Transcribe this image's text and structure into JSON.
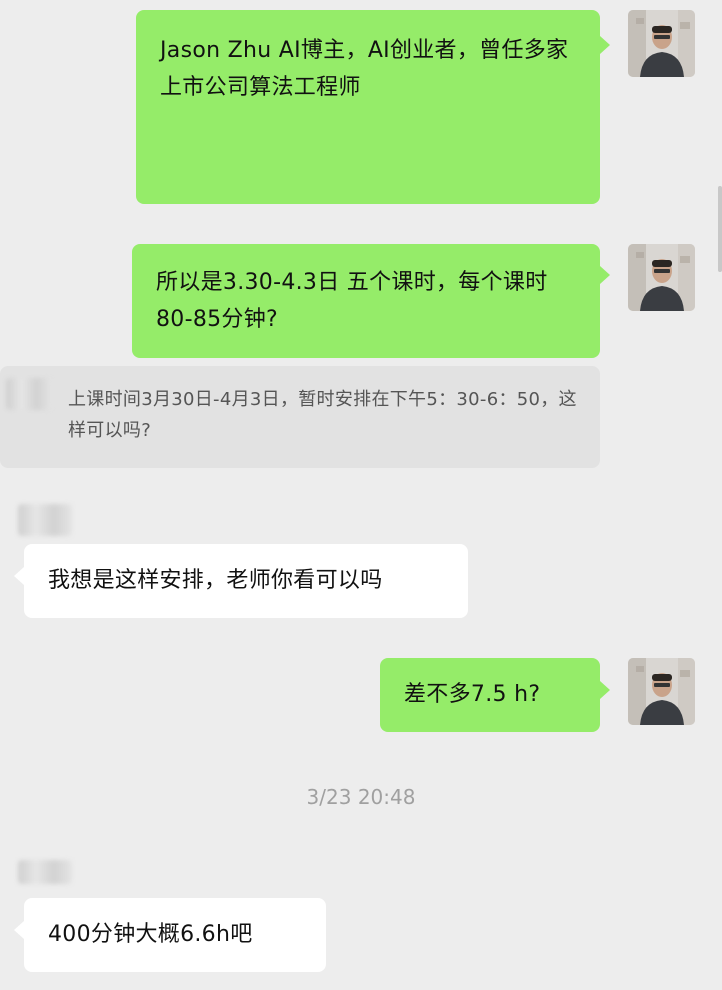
{
  "messages": {
    "m1": "Jason Zhu AI博主，AI创业者，曾任多家上市公司算法工程师",
    "m2": "所以是3.30-4.3日 五个课时，每个课时80-85分钟?",
    "m3_quote": "上课时间3月30日-4月3日，暂时安排在下午5：30-6：50，这样可以吗?",
    "m4": "我想是这样安排，老师你看可以吗",
    "m5": "差不多7.5 h?",
    "m6": "400分钟大概6.6h吧"
  },
  "timestamp": "3/23 20:48",
  "colors": {
    "background": "#ededed",
    "outgoing_bubble": "#95ec69",
    "incoming_bubble": "#ffffff",
    "quote_bubble": "#e2e2e2"
  },
  "icons": {
    "avatar": "user-avatar-photo"
  }
}
